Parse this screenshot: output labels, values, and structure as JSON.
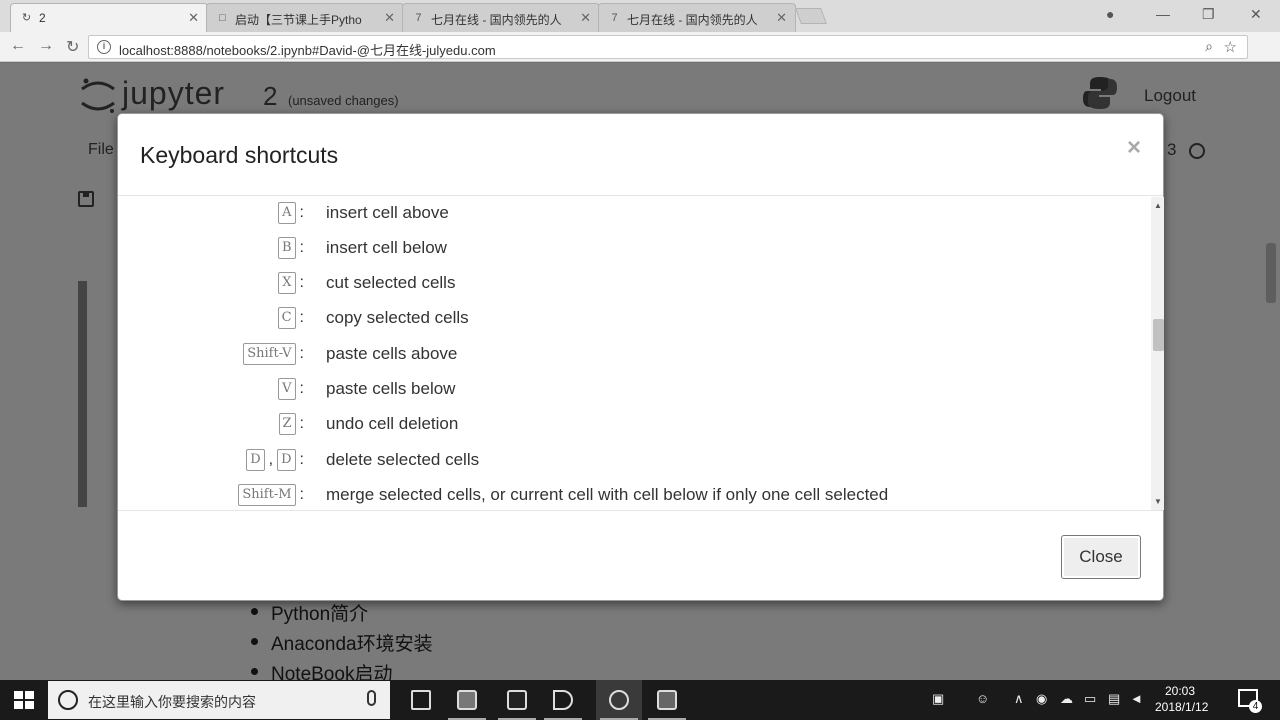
{
  "browser": {
    "tabs": [
      {
        "title": "2",
        "icon": "refresh-icon",
        "active": true
      },
      {
        "title": "启动【三节课上手Pytho",
        "icon": "page-icon",
        "active": false
      },
      {
        "title": "七月在线 - 国内领先的人",
        "icon": "julyedu-icon",
        "active": false
      },
      {
        "title": "七月在线 - 国内领先的人",
        "icon": "julyedu-icon",
        "active": false
      }
    ],
    "url": "localhost:8888/notebooks/2.ipynb#David-@七月在线-julyedu.com"
  },
  "jupyter": {
    "logo_text": "jupyter",
    "notebook_name": "2",
    "save_status": "(unsaved changes)",
    "logout_label": "Logout",
    "menu_file_label": "File",
    "kernel_label": "3",
    "outline": [
      "Python简介",
      "Anaconda环境安装",
      "NoteBook启动"
    ]
  },
  "modal": {
    "title": "Keyboard shortcuts",
    "close_x": "×",
    "close_button": "Close",
    "shortcuts": [
      {
        "keys": [
          "A"
        ],
        "desc": "insert cell above"
      },
      {
        "keys": [
          "B"
        ],
        "desc": "insert cell below"
      },
      {
        "keys": [
          "X"
        ],
        "desc": "cut selected cells"
      },
      {
        "keys": [
          "C"
        ],
        "desc": "copy selected cells"
      },
      {
        "keys": [
          "Shift-V"
        ],
        "desc": "paste cells above"
      },
      {
        "keys": [
          "V"
        ],
        "desc": "paste cells below"
      },
      {
        "keys": [
          "Z"
        ],
        "desc": "undo cell deletion"
      },
      {
        "keys": [
          "D",
          "D"
        ],
        "desc": "delete selected cells"
      },
      {
        "keys": [
          "Shift-M"
        ],
        "desc": "merge selected cells, or current cell with cell below if only one cell selected"
      }
    ]
  },
  "taskbar": {
    "search_placeholder": "在这里输入你要搜索的内容",
    "time": "20:03",
    "date": "2018/1/12",
    "notification_count": "4"
  }
}
